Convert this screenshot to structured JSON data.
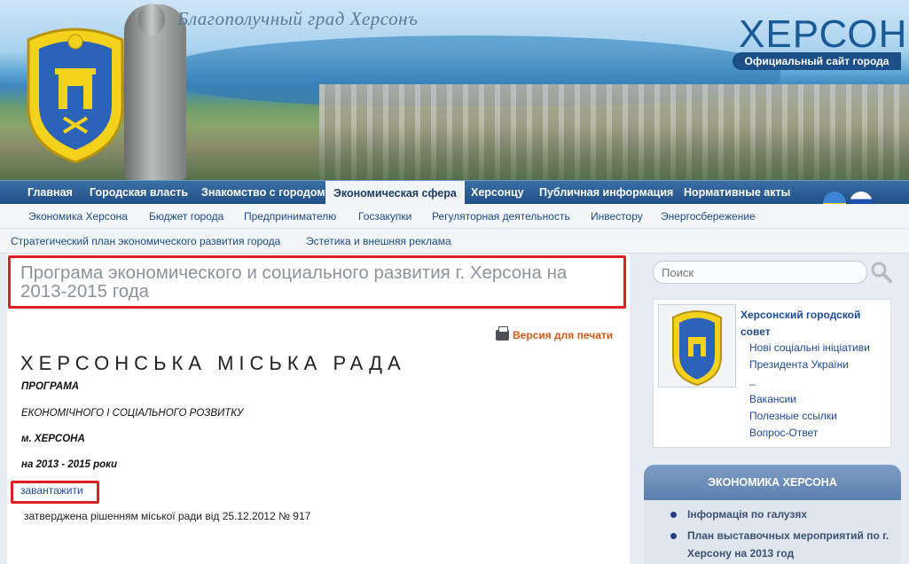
{
  "header": {
    "tagline": "Благополучный град Херсонъ",
    "logo_title": "ХЕРСОН",
    "logo_subtitle": "Официальный сайт города"
  },
  "main_nav": [
    {
      "label": "Главная"
    },
    {
      "label": "Городская власть"
    },
    {
      "label": "Знакомство с городом"
    },
    {
      "label": "Экономическая сфера",
      "active": true
    },
    {
      "label": "Херсонцу"
    },
    {
      "label": "Публичная информация"
    },
    {
      "label": "Нормативные акты"
    }
  ],
  "sub_nav": {
    "row1": [
      "Экономика Херсона",
      "Бюджет города",
      "Предпринимателю",
      "Госзакупки",
      "Регуляторная деятельность",
      "Инвестору",
      "Энергосбережение"
    ],
    "row2": [
      "Стратегический план экономического развития города",
      "Эстетика и внешняя реклама"
    ]
  },
  "page": {
    "title": "Програма экономического и социального развития г. Херсона на 2013-2015 года",
    "print_label": "Версия для печати",
    "council": "ХЕРСОНСЬКА МІСЬКА РАДА",
    "doc_lines": [
      "ПРОГРАМА",
      "ЕКОНОМІЧНОГО І СОЦІАЛЬНОГО РОЗВИТКУ",
      "м. ХЕРСОНА",
      "на 2013 - 2015 роки"
    ],
    "download_label": "завантажити",
    "approved": "затверджена рішенням міської ради від 25.12.2012 № 917"
  },
  "sidebar": {
    "search_placeholder": "Поиск",
    "card": {
      "heading": "Херсонский городской совет",
      "links": [
        "Нові соціальні ініціативи",
        "Президента України",
        "–",
        "Вакансии",
        "Полезные ссылки",
        "Вопрос-Ответ"
      ]
    },
    "panel": {
      "title": "ЭКОНОМИКА ХЕРСОНА",
      "items": [
        "Інформація по галузях",
        "План выставочных мероприятий по г. Херсону на 2013 год"
      ]
    }
  },
  "colors": {
    "nav_bg": "#1f4f85",
    "link": "#1d4a9a",
    "print_link": "#d45a1a",
    "highlight_border": "#e02020"
  }
}
